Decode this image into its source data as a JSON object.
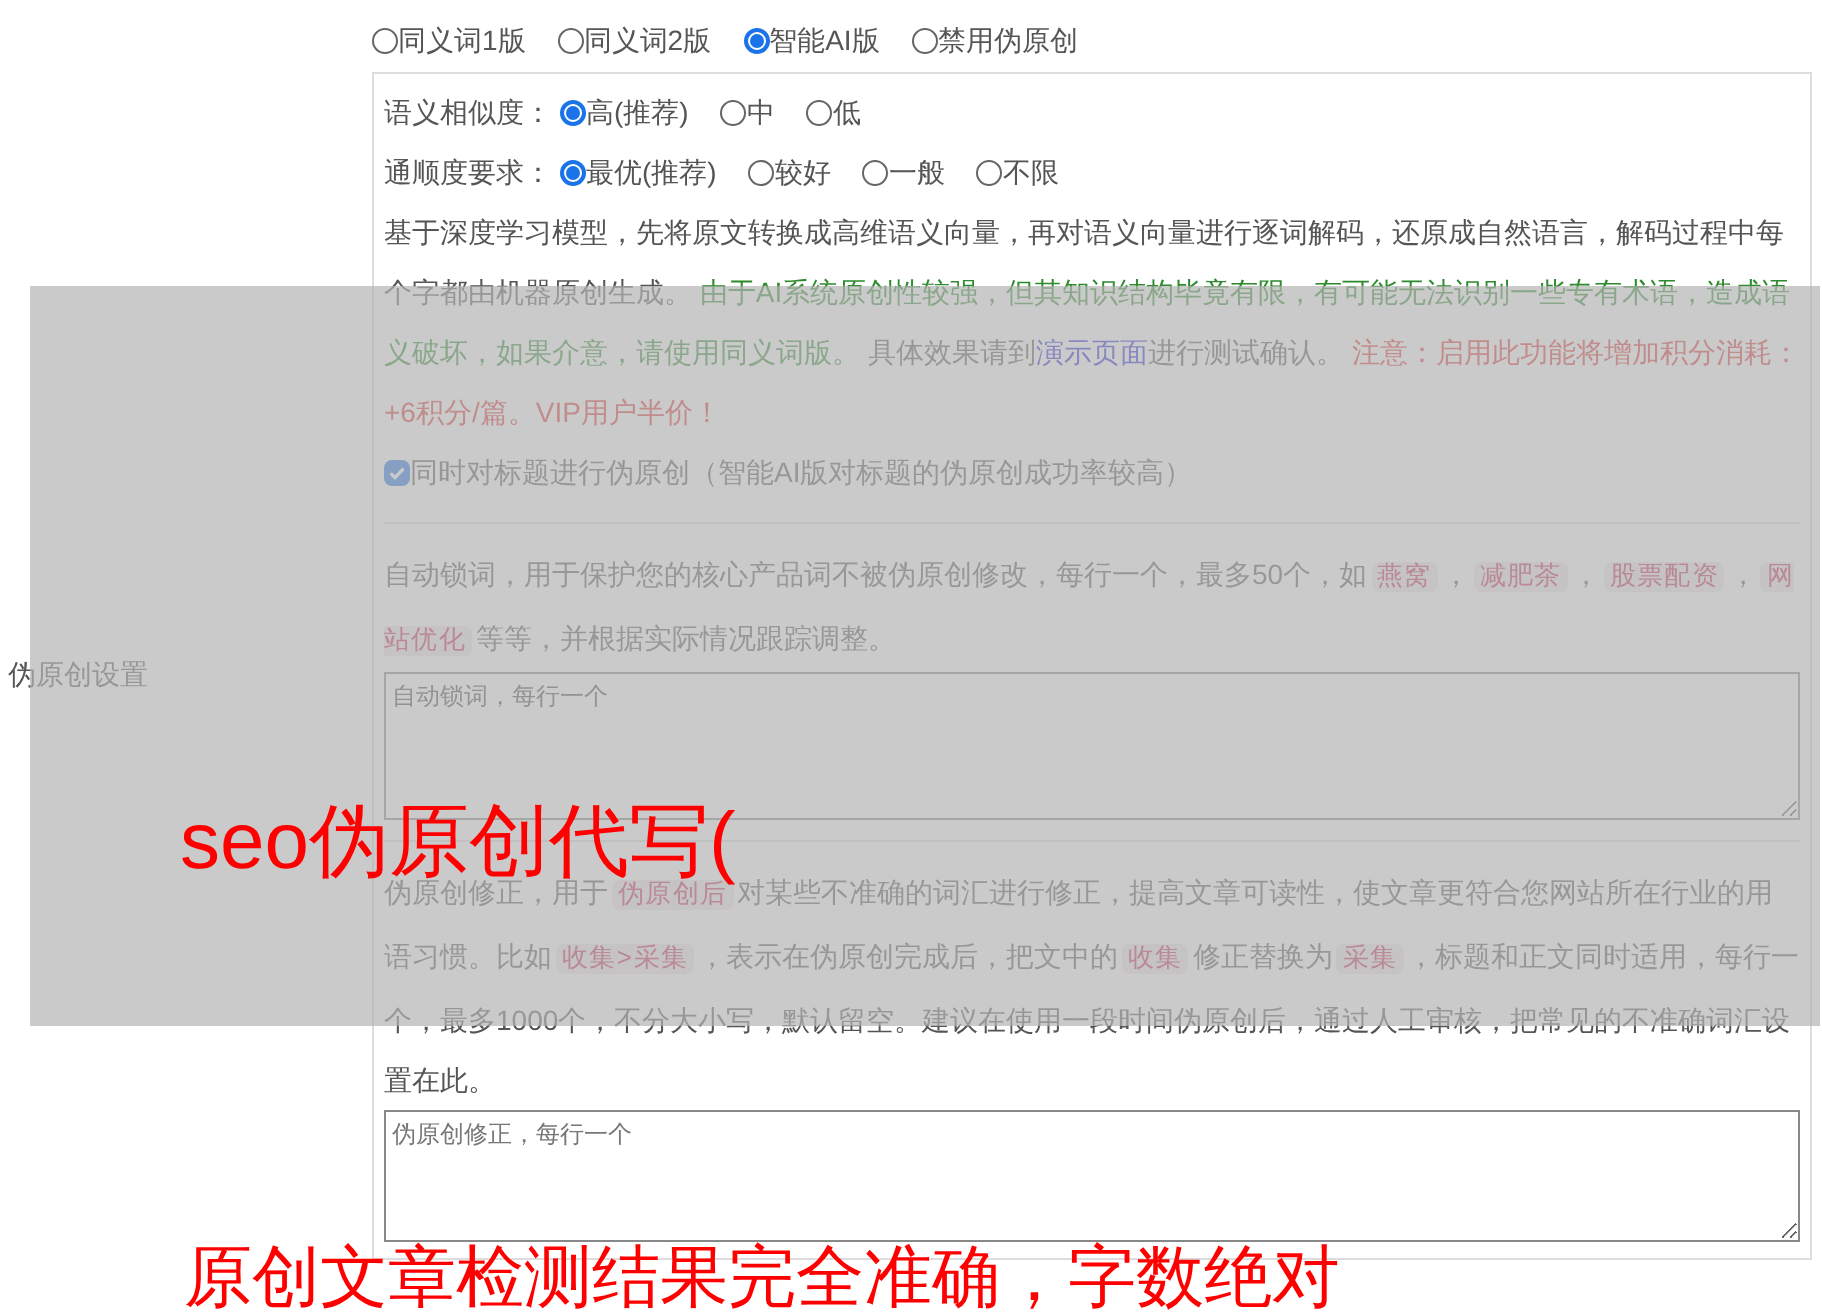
{
  "settings_label": "伪原创设置",
  "modes": [
    {
      "label": "同义词1版",
      "selected": false
    },
    {
      "label": "同义词2版",
      "selected": false
    },
    {
      "label": "智能AI版",
      "selected": true
    },
    {
      "label": "禁用伪原创",
      "selected": false
    }
  ],
  "similarity": {
    "label": "语义相似度：",
    "options": [
      {
        "label": "高(推荐)",
        "selected": true
      },
      {
        "label": "中",
        "selected": false
      },
      {
        "label": "低",
        "selected": false
      }
    ]
  },
  "fluency": {
    "label": "通顺度要求：",
    "options": [
      {
        "label": "最优(推荐)",
        "selected": true
      },
      {
        "label": "较好",
        "selected": false
      },
      {
        "label": "一般",
        "selected": false
      },
      {
        "label": "不限",
        "selected": false
      }
    ]
  },
  "description": [
    {
      "kind": "plain",
      "text": "基于深度学习模型，先将原文转换成高维语义向量，再对语义向量进行逐词解码，还原成自然语言，解码过程中每个字都由机器原创生成。 "
    },
    {
      "kind": "warning",
      "text": "由于AI系统原创性较强，但其知识结构毕竟有限，有可能无法识别一些专有术语，造成语义破坏，如果介意，请使用同义词版。"
    },
    {
      "kind": "plain",
      "text": " 具体效果请到"
    },
    {
      "kind": "link",
      "text": "演示页面"
    },
    {
      "kind": "plain",
      "text": "进行测试确认。 "
    },
    {
      "kind": "note",
      "text": "注意：启用此功能将增加积分消耗：+6积分/篇。VIP用户半价！"
    }
  ],
  "title_option": {
    "label": "同时对标题进行伪原创（智能AI版对标题的伪原创成功率较高）",
    "checked": true
  },
  "lock_words": {
    "text": [
      {
        "kind": "plain",
        "text": "自动锁词，用于保护您的核心产品词不被伪原创修改，每行一个，最多50个，如"
      },
      {
        "kind": "tag",
        "text": "燕窝"
      },
      {
        "kind": "plain",
        "text": "，"
      },
      {
        "kind": "tag",
        "text": "减肥茶"
      },
      {
        "kind": "plain",
        "text": "，"
      },
      {
        "kind": "tag",
        "text": "股票配资"
      },
      {
        "kind": "plain",
        "text": "，"
      },
      {
        "kind": "tag",
        "text": "网站优化"
      },
      {
        "kind": "plain",
        "text": "等等，并根据实际情况跟踪调整。"
      }
    ],
    "placeholder": "自动锁词，每行一个"
  },
  "correction": {
    "text": [
      {
        "kind": "plain",
        "text": "伪原创修正，用于"
      },
      {
        "kind": "tag",
        "text": "伪原创后"
      },
      {
        "kind": "plain",
        "text": "对某些不准确的词汇进行修正，提高文章可读性，使文章更符合您网站所在行业的用语习惯。比如"
      },
      {
        "kind": "tag",
        "text": "收集>采集"
      },
      {
        "kind": "plain",
        "text": "，表示在伪原创完成后，把文中的"
      },
      {
        "kind": "tag",
        "text": "收集"
      },
      {
        "kind": "plain",
        "text": "修正替换为"
      },
      {
        "kind": "tag",
        "text": "采集"
      },
      {
        "kind": "plain",
        "text": "，标题和正文同时适用，每行一个，最多1000个，不分大小写，默认留空。建议在使用一段时间伪原创后，通过人工审核，把常见的不准确词汇设置在此。"
      }
    ],
    "placeholder": "伪原创修正，每行一个"
  },
  "overlay": {
    "title": "seo伪原创代写(",
    "caption": "原创文章检测结果完全准确，字数绝对"
  }
}
